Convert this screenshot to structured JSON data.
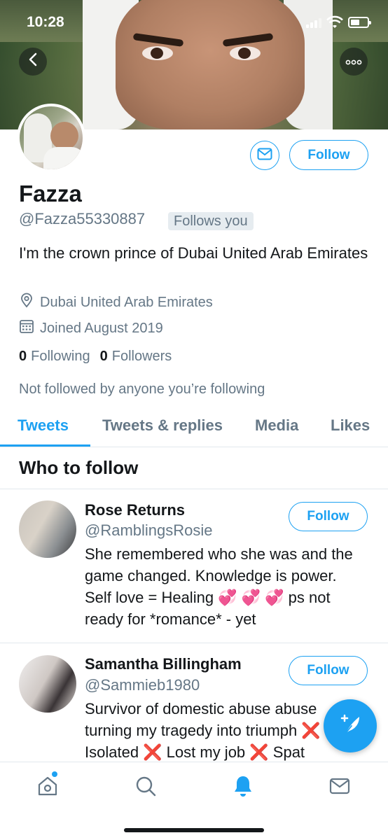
{
  "status_bar": {
    "time": "10:28"
  },
  "profile": {
    "name": "Fazza",
    "handle": "@Fazza55330887",
    "follows_you": "Follows you",
    "follow_label": "Follow",
    "bio": "I'm the crown prince of Dubai United Arab Emirates",
    "location": "Dubai United Arab Emirates",
    "joined": "Joined August 2019",
    "following_count": "0",
    "following_label": "Following",
    "followers_count": "0",
    "followers_label": "Followers",
    "not_followed": "Not followed by anyone you’re following"
  },
  "tabs": [
    {
      "label": "Tweets",
      "active": true
    },
    {
      "label": "Tweets & replies",
      "active": false
    },
    {
      "label": "Media",
      "active": false
    },
    {
      "label": "Likes",
      "active": false
    }
  ],
  "who_to_follow": {
    "title": "Who to follow",
    "suggestions": [
      {
        "name": "Rose Returns",
        "handle": "@RamblingsRosie",
        "bio": "She remembered who she was and the game changed. Knowledge is power. Self love = Healing 💞 💞 💞 ps not ready for *romance* - yet",
        "follow_label": "Follow"
      },
      {
        "name": "Samantha Billingham",
        "handle": "@Sammieb1980",
        "bio": "Survivor of domestic abuse abuse turning my tragedy into triumph ❌ Isolated ❌ Lost my job ❌ Spat",
        "follow_label": "Follow"
      }
    ]
  },
  "icons": {
    "back": "chevron-left-icon",
    "more": "more-icon",
    "message": "mail-icon",
    "location": "location-pin-icon",
    "calendar": "calendar-icon",
    "compose": "compose-tweet-icon",
    "nav": [
      "home-icon",
      "search-icon",
      "notifications-icon",
      "messages-icon"
    ]
  },
  "colors": {
    "accent": "#1da1f2",
    "secondary_text": "#657786",
    "primary_text": "#14171a"
  }
}
